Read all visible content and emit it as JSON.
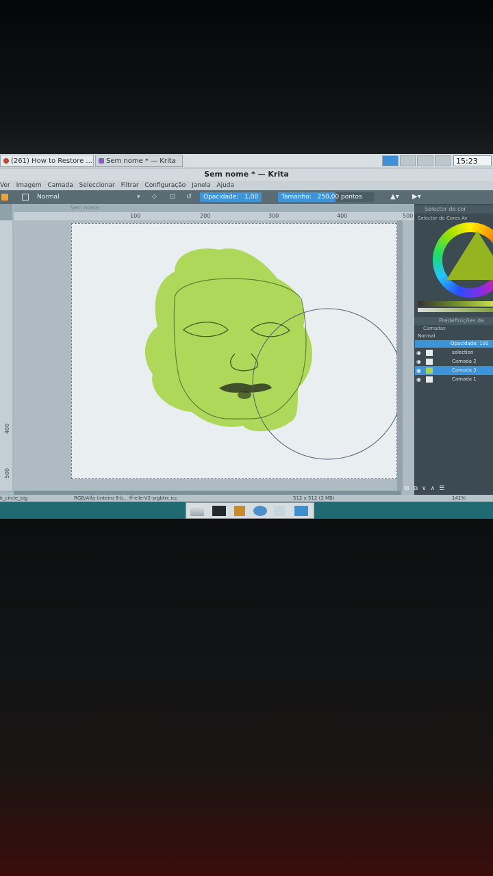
{
  "browser_tabs": [
    {
      "label": "(261) How to Restore ..."
    },
    {
      "label": "Sem nome * — Krita"
    }
  ],
  "clock": "15:23",
  "window_title": "Sem nome * — Krita",
  "menu": [
    "Ver",
    "Imagem",
    "Camada",
    "Seleccionar",
    "Filtrar",
    "Configuração",
    "Janela",
    "Ajuda"
  ],
  "toolbar": {
    "blend_mode": "Normal",
    "opacity_label": "Opacidade:",
    "opacity_value": "1,00",
    "size_label": "Tamanho:",
    "size_value": "250,00 pontos"
  },
  "document_tab": "Sem nome",
  "ruler": {
    "top": [
      "100",
      "200",
      "300",
      "400",
      "500"
    ],
    "left": [
      "400",
      "500"
    ]
  },
  "dockers": {
    "color_title": "Selector de cor",
    "color_sub": "Selector de Cores Av",
    "layers_title": "Predefinições de",
    "layers_sub": "Camadas",
    "blend": "Normal",
    "opacity": "Opacidade:  100",
    "layers": [
      {
        "name": "selection",
        "selected": false
      },
      {
        "name": "Camada 2",
        "selected": false
      },
      {
        "name": "Camada 3",
        "selected": true
      },
      {
        "name": "Camada 1",
        "selected": false
      }
    ]
  },
  "status": {
    "brush": "k_circle_big",
    "colorspace": "RGB/Alfa (inteiro 8-b... ff-elle-V2-srgbtrc.icc",
    "dimensions": "512 x 512 (3 MB)",
    "zoom": "141%"
  },
  "colors": {
    "paint": "#a9d64e",
    "accent": "#3d94d8",
    "panel": "#3c4a51",
    "taskbar_teal": "#1f6a73"
  },
  "taskbar_icons": [
    "files-icon",
    "terminal-icon",
    "archive-icon",
    "browser-icon",
    "search-icon",
    "folder-icon"
  ]
}
